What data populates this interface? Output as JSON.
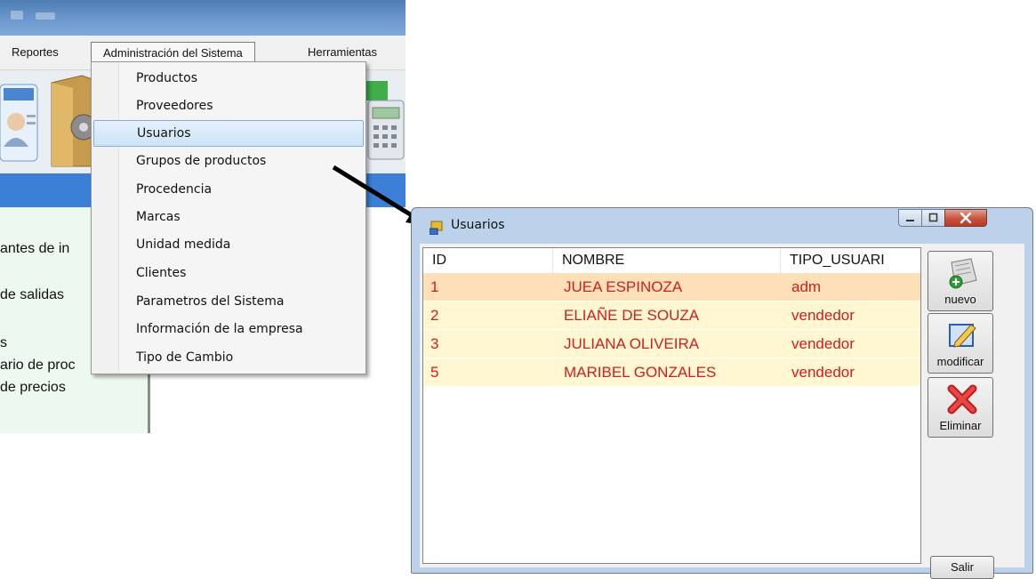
{
  "menubar": {
    "items": [
      "Reportes",
      "Administración del Sistema",
      "Herramientas"
    ]
  },
  "dropdown": {
    "items": [
      "Productos",
      "Proveedores",
      "Usuarios",
      "Grupos de productos",
      "Procedencia",
      "Marcas",
      "Unidad medida",
      "Clientes",
      "Parametros del Sistema",
      "Información de la empresa",
      "Tipo de Cambio"
    ],
    "selected": "Usuarios"
  },
  "side_panel": {
    "lines": [
      "antes de in",
      "de salidas",
      "s",
      "ario de proc",
      "de precios"
    ]
  },
  "window": {
    "title": "Usuarios",
    "columns": [
      "ID",
      "NOMBRE",
      "TIPO_USUARI"
    ],
    "rows": [
      {
        "id": "1",
        "nombre": "JUEA ESPINOZA",
        "tipo": "adm"
      },
      {
        "id": "2",
        "nombre": "ELIAÑE DE SOUZA",
        "tipo": "vendedor"
      },
      {
        "id": "3",
        "nombre": "JULIANA OLIVEIRA",
        "tipo": "vendedor"
      },
      {
        "id": "5",
        "nombre": "MARIBEL GONZALES",
        "tipo": "vendedor"
      }
    ],
    "buttons": {
      "nuevo": "nuevo",
      "modificar": "modificar",
      "eliminar": "Eliminar",
      "salir": "Salir"
    }
  },
  "colors": {
    "title_bar": "#6f9bd0",
    "blue_bar": "#3c7fd6",
    "row_text": "#cc1f1f",
    "row_selected_bg": "#fde0b8",
    "row_bg": "#fff7d1",
    "menu_highlight": "#cde4f7"
  }
}
